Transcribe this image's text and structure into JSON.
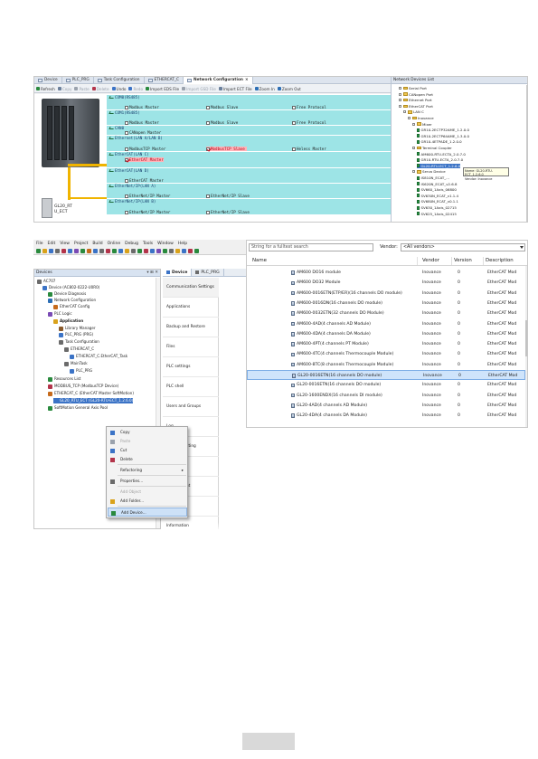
{
  "network_config": {
    "tabs": [
      "Device",
      "PLC_PRG",
      "Task Configuration",
      "ETHERCAT_C",
      "Network Configuration"
    ],
    "active_tab_close": "×",
    "toolbar": [
      "Refresh",
      "Copy",
      "Paste",
      "Delete",
      "Undo",
      "Redo",
      "Import EDS File",
      "Import GSD File",
      "Import ECT File",
      "Zoom In",
      "Zoom Out"
    ],
    "rtu_label": "GL20_RT\nU_ECT",
    "ports": [
      {
        "title": "COM0(RS485)",
        "options": [
          {
            "label": "Modbus Master",
            "checked": false
          },
          {
            "label": "Modbus Slave",
            "checked": false
          },
          {
            "label": "Free Protocol",
            "checked": false
          }
        ]
      },
      {
        "title": "COM1(RS485)",
        "options": [
          {
            "label": "Modbus Master",
            "checked": false
          },
          {
            "label": "Modbus Slave",
            "checked": false
          },
          {
            "label": "Free Protocol",
            "checked": false
          }
        ]
      },
      {
        "title": "CAN0",
        "options": [
          {
            "label": "CANopen Master",
            "checked": false
          }
        ]
      },
      {
        "title": "Ethernet(LAN A/LAN B)",
        "options": [
          {
            "label": "ModbusTCP Master",
            "checked": false
          },
          {
            "label": "ModbusTCP Slave",
            "checked": true
          },
          {
            "label": "Heless Master",
            "checked": false
          }
        ]
      },
      {
        "title": "EtherCAT(LAN C)",
        "options": [
          {
            "label": "EtherCAT Master",
            "checked": true
          }
        ]
      },
      {
        "title": "EtherCAT(LAN D)",
        "options": [
          {
            "label": "EtherCAT Master",
            "checked": false
          }
        ]
      },
      {
        "title": "EtherNet/IP(LAN A)",
        "options": [
          {
            "label": "EtherNet/IP Master",
            "checked": false
          },
          {
            "label": "EtherNet/IP Slave",
            "checked": false
          }
        ]
      },
      {
        "title": "EtherNet/IP(LAN B)",
        "options": [
          {
            "label": "EtherNet/IP Master",
            "checked": false
          },
          {
            "label": "EtherNet/IP Slave",
            "checked": false
          }
        ]
      }
    ],
    "tree_title": "Network Devices List",
    "tree": [
      {
        "label": "Serial Port",
        "indent": 1,
        "type": "folder"
      },
      {
        "label": "CANopen Port",
        "indent": 1,
        "type": "folder"
      },
      {
        "label": "Ethernet Port",
        "indent": 1,
        "type": "folder"
      },
      {
        "label": "EtherCAT Port",
        "indent": 1,
        "type": "folder"
      },
      {
        "label": "LAN C",
        "indent": 2,
        "type": "folder"
      },
      {
        "label": "Inovance",
        "indent": 3,
        "type": "folder"
      },
      {
        "label": "Mixer",
        "indent": 4,
        "type": "folder"
      },
      {
        "label": "GR10-2ECTP32AME_1.2.0.0",
        "indent": 5,
        "type": "device"
      },
      {
        "label": "GR10-2ECTP64AME_1.3.0.0",
        "indent": 5,
        "type": "device"
      },
      {
        "label": "GR10-4ETPADE_1.2.0.0",
        "indent": 5,
        "type": "device"
      },
      {
        "label": "Terminal Coupler",
        "indent": 4,
        "type": "folder"
      },
      {
        "label": "AM600-RTU-ECTA_2.0.7.0",
        "indent": 5,
        "type": "device"
      },
      {
        "label": "GR10-RTU-ECTA_2.0.7.0",
        "indent": 5,
        "type": "device"
      },
      {
        "label": "GL20-RTU-ECT_1.2.6.0",
        "indent": 5,
        "type": "device",
        "selected": true
      },
      {
        "label": "Servo Device",
        "indent": 4,
        "type": "folder"
      },
      {
        "label": "IS810N_ECAT_...",
        "indent": 5,
        "type": "device"
      },
      {
        "label": "IS620N_ECAT_v2.6.8",
        "indent": 5,
        "type": "device"
      },
      {
        "label": "SV660_1Axis_06800",
        "indent": 5,
        "type": "device"
      },
      {
        "label": "SV630N_ECAT_v1.1.4",
        "indent": 5,
        "type": "device"
      },
      {
        "label": "SV680N_ECAT_v0.1.1",
        "indent": 5,
        "type": "device"
      },
      {
        "label": "SV630_1Axis_02715",
        "indent": 5,
        "type": "device"
      },
      {
        "label": "SV625_1Axis_02415",
        "indent": 5,
        "type": "device"
      }
    ],
    "tooltip": [
      "Name: GL20-RTU-ECT_1.2.6.0",
      "Vendor: Inovance"
    ]
  },
  "ide": {
    "menu": [
      "File",
      "Edit",
      "View",
      "Project",
      "Build",
      "Online",
      "Debug",
      "Tools",
      "Window",
      "Help"
    ],
    "devices_title": "Devices",
    "devices_ctrl": "▾ ⊞ ✕",
    "tree": [
      {
        "label": "AC707",
        "indent": 0,
        "icon": "project"
      },
      {
        "label": "Device (AC802-0222-U0R0)",
        "indent": 1,
        "icon": "device"
      },
      {
        "label": "Device Diagnosis",
        "indent": 2,
        "icon": "diag"
      },
      {
        "label": "Network Configuration",
        "indent": 2,
        "icon": "net"
      },
      {
        "label": "EtherCAT Config",
        "indent": 3,
        "icon": "ecat"
      },
      {
        "label": "PLC Logic",
        "indent": 2,
        "icon": "logic"
      },
      {
        "label": "Application",
        "indent": 3,
        "icon": "app",
        "bold": true
      },
      {
        "label": "Library Manager",
        "indent": 4,
        "icon": "lib"
      },
      {
        "label": "PLC_PRG (PRG)",
        "indent": 4,
        "icon": "prg"
      },
      {
        "label": "Task Configuration",
        "indent": 4,
        "icon": "task"
      },
      {
        "label": "ETHERCAT_C",
        "indent": 5,
        "icon": "task"
      },
      {
        "label": "ETHERCAT_C.EtherCAT_Task",
        "indent": 6,
        "icon": "prg"
      },
      {
        "label": "MainTask",
        "indent": 5,
        "icon": "task"
      },
      {
        "label": "PLC_PRG",
        "indent": 6,
        "icon": "prg"
      },
      {
        "label": "Resources List",
        "indent": 2,
        "icon": "res"
      },
      {
        "label": "MODBUS_TCP (ModbusTCP Device)",
        "indent": 2,
        "icon": "modbus"
      },
      {
        "label": "ETHERCAT_C (EtherCAT Master SoftMotion)",
        "indent": 2,
        "icon": "ecat"
      },
      {
        "label": "GL20_RTU_ECT (GL20-RTU-ECT_1.2.6.0)",
        "indent": 3,
        "icon": "device",
        "selected": true
      },
      {
        "label": "SoftMotion General Axis Pool",
        "indent": 2,
        "icon": "motion"
      }
    ],
    "editor_tabs": [
      "Device",
      "PLC_PRG"
    ],
    "side_menu": [
      "Communication Settings",
      "Applications",
      "Backup and Restore",
      "Files",
      "PLC settings",
      "PLC shell",
      "Users and Groups",
      "Log",
      "System Setting",
      "Upgrade",
      "Deployment",
      "",
      "Information"
    ],
    "context_menu": [
      {
        "label": "Copy",
        "enabled": true
      },
      {
        "label": "Paste",
        "enabled": false
      },
      {
        "label": "Cut",
        "enabled": true
      },
      {
        "label": "Delete",
        "enabled": true
      },
      {
        "label": "Refactoring",
        "enabled": true,
        "submenu": true
      },
      {
        "label": "Properties...",
        "enabled": true
      },
      {
        "label": "Add Object",
        "enabled": false
      },
      {
        "label": "Add Folder...",
        "enabled": true
      },
      {
        "label": "Add Device...",
        "enabled": true,
        "highlight": true
      }
    ]
  },
  "catalog": {
    "search_placeholder": "String for a fulltext search",
    "vendor_label": "Vendor:",
    "vendor_value": "<All vendors>",
    "headers": {
      "name": "Name",
      "vendor": "Vendor",
      "version": "Version",
      "description": "Description"
    },
    "rows": [
      {
        "name": "AM600 DO16 module",
        "vendor": "Inovance",
        "version": "0",
        "description": "EtherCAT Mod"
      },
      {
        "name": "AM600 DO32 Module",
        "vendor": "Inovance",
        "version": "0",
        "description": "EtherCAT Mod"
      },
      {
        "name": "AM600-0016ETN(ETP/ER)(16 channels DO module)",
        "vendor": "Inovance",
        "version": "0",
        "description": "EtherCAT Mod"
      },
      {
        "name": "AM600-0016DN(16 channels DO module)",
        "vendor": "Inovance",
        "version": "0",
        "description": "EtherCAT Mod"
      },
      {
        "name": "AM600-0032ETN(32 channels DO Module)",
        "vendor": "Inovance",
        "version": "0",
        "description": "EtherCAT Mod"
      },
      {
        "name": "AM600-4AD(4 channels AD Module)",
        "vendor": "Inovance",
        "version": "0",
        "description": "EtherCAT Mod"
      },
      {
        "name": "AM600-4DA(4 channels DA Module)",
        "vendor": "Inovance",
        "version": "0",
        "description": "EtherCAT Mod"
      },
      {
        "name": "AM600-4PT(4 channels PT Module)",
        "vendor": "Inovance",
        "version": "0",
        "description": "EtherCAT Mod"
      },
      {
        "name": "AM600-4TC(4 channels Thermocouple Module)",
        "vendor": "Inovance",
        "version": "0",
        "description": "EtherCAT Mod"
      },
      {
        "name": "AM600-8TC(8 channels Thermocouple Module)",
        "vendor": "Inovance",
        "version": "0",
        "description": "EtherCAT Mod"
      },
      {
        "name": "GL20-0016ETN(16 channels DO module)",
        "vendor": "Inovance",
        "version": "0",
        "description": "EtherCAT Mod",
        "selected": true
      },
      {
        "name": "GL20-0016ETN(16 channels DO module)",
        "vendor": "Inovance",
        "version": "0",
        "description": "EtherCAT Mod"
      },
      {
        "name": "GL20-1600ENDX(16 channels DI module)",
        "vendor": "Inovance",
        "version": "0",
        "description": "EtherCAT Mod"
      },
      {
        "name": "GL20-4AD(4 channels AD Module)",
        "vendor": "Inovance",
        "version": "0",
        "description": "EtherCAT Mod"
      },
      {
        "name": "GL20-4DA(4 channels DA Module)",
        "vendor": "Inovance",
        "version": "0",
        "description": "EtherCAT Mod"
      }
    ]
  },
  "colors": {
    "port_bg": "#9de4e6",
    "selection": "#3b73c6",
    "highlight_red": "#ffb3b8",
    "bus_yellow": "#f0b400"
  }
}
